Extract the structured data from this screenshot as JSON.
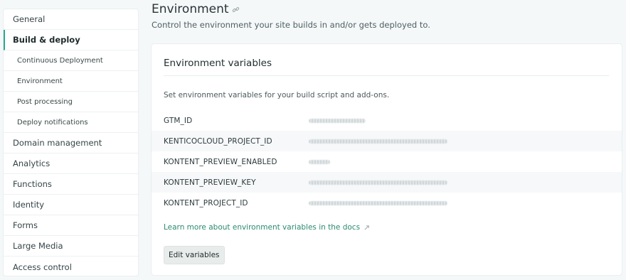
{
  "sidebar": {
    "items": [
      {
        "label": "General",
        "name": "sidebar-item-general",
        "type": "main"
      },
      {
        "label": "Build & deploy",
        "name": "sidebar-item-build-deploy",
        "type": "main-active"
      },
      {
        "label": "Continuous Deployment",
        "name": "sidebar-item-continuous-deployment",
        "type": "sub"
      },
      {
        "label": "Environment",
        "name": "sidebar-item-environment",
        "type": "sub"
      },
      {
        "label": "Post processing",
        "name": "sidebar-item-post-processing",
        "type": "sub"
      },
      {
        "label": "Deploy notifications",
        "name": "sidebar-item-deploy-notifications",
        "type": "sub"
      },
      {
        "label": "Domain management",
        "name": "sidebar-item-domain-management",
        "type": "main"
      },
      {
        "label": "Analytics",
        "name": "sidebar-item-analytics",
        "type": "main"
      },
      {
        "label": "Functions",
        "name": "sidebar-item-functions",
        "type": "main"
      },
      {
        "label": "Identity",
        "name": "sidebar-item-identity",
        "type": "main"
      },
      {
        "label": "Forms",
        "name": "sidebar-item-forms",
        "type": "main"
      },
      {
        "label": "Large Media",
        "name": "sidebar-item-large-media",
        "type": "main"
      },
      {
        "label": "Access control",
        "name": "sidebar-item-access-control",
        "type": "main"
      }
    ]
  },
  "header": {
    "title": "Environment",
    "title_icon": "link-icon",
    "subtitle": "Control the environment your site builds in and/or gets deployed to."
  },
  "card": {
    "title": "Environment variables",
    "description": "Set environment variables for your build script and add-ons.",
    "variables": [
      {
        "key": "GTM_ID"
      },
      {
        "key": "KENTICOCLOUD_PROJECT_ID"
      },
      {
        "key": "KONTENT_PREVIEW_ENABLED"
      },
      {
        "key": "KONTENT_PREVIEW_KEY"
      },
      {
        "key": "KONTENT_PROJECT_ID"
      }
    ],
    "learn_link": "Learn more about environment variables in the docs",
    "learn_icon": "external-link-icon",
    "edit_button": "Edit variables"
  },
  "colors": {
    "accent": "#2aa88d",
    "link": "#2b8a6f",
    "page_background": "#f5f8f9"
  }
}
